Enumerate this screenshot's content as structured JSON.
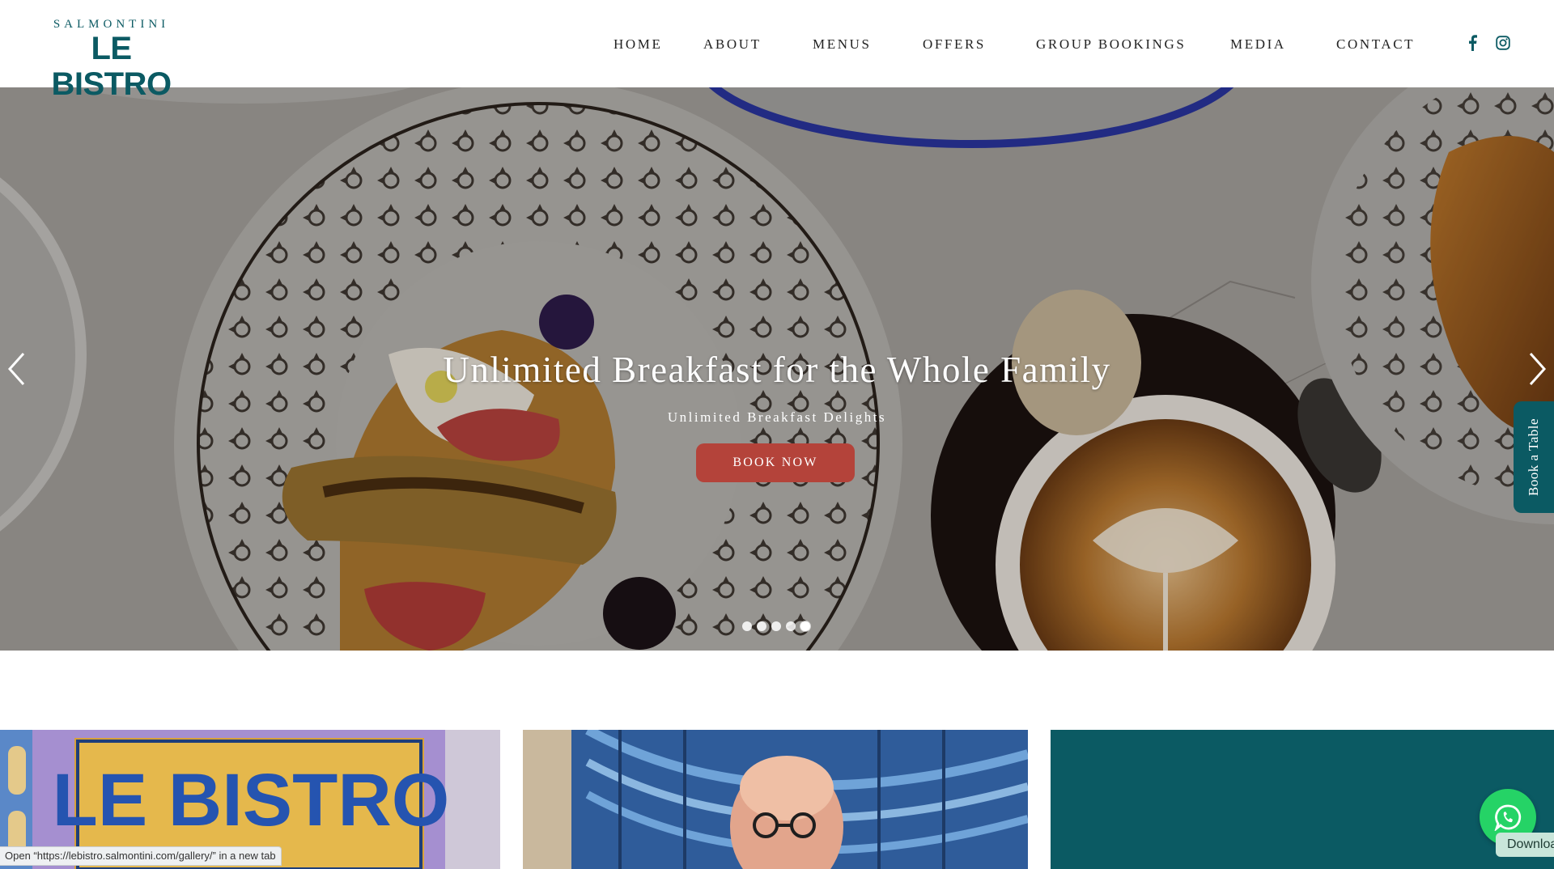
{
  "brand": {
    "logo_top": "SALMONTINI",
    "logo_main": "LE BISTRO",
    "color_primary": "#0b5a63",
    "color_accent": "#b4433a"
  },
  "nav": {
    "items": [
      {
        "label": "HOME"
      },
      {
        "label": "ABOUT"
      },
      {
        "label": "MENUS"
      },
      {
        "label": "OFFERS"
      },
      {
        "label": "GROUP BOOKINGS"
      },
      {
        "label": "MEDIA"
      },
      {
        "label": "CONTACT"
      }
    ],
    "social": [
      {
        "icon": "facebook-icon"
      },
      {
        "icon": "instagram-icon"
      }
    ]
  },
  "hero": {
    "title": "Unlimited Breakfast for the Whole Family",
    "subtitle": "Unlimited Breakfast Delights",
    "button_label": "BOOK NOW",
    "slide_count": 5,
    "active_slide": 5,
    "prev_icon": "chevron-left-icon",
    "next_icon": "chevron-right-icon"
  },
  "side_tab": {
    "label": "Book a Table"
  },
  "cards": [
    {
      "name": "le-bistro-sign",
      "sign_text": "LE BISTRO"
    },
    {
      "name": "chef-portrait"
    },
    {
      "name": "teal-panel"
    }
  ],
  "whatsapp": {
    "icon": "whatsapp-icon",
    "download_label": "Download"
  },
  "status_bar": {
    "prefix": "Open “",
    "url": "https://lebistro.salmontini.com/gallery/",
    "suffix": "” in a new tab"
  }
}
